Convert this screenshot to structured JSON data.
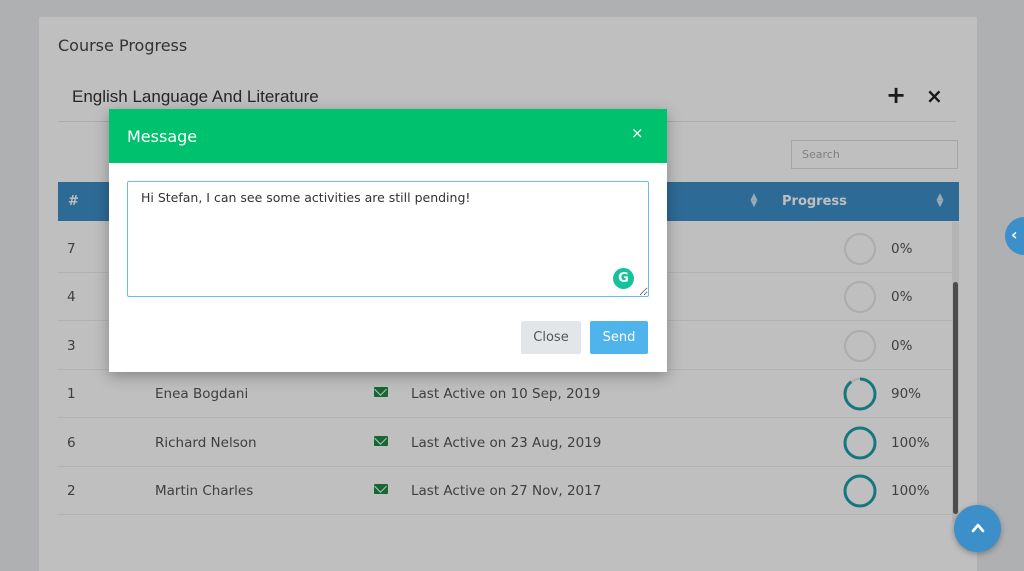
{
  "page": {
    "title": "Course Progress"
  },
  "panel": {
    "title": "English Language And Literature",
    "add_label": "+",
    "close_label": "×"
  },
  "search": {
    "placeholder": "Search"
  },
  "table": {
    "headers": {
      "index": "#",
      "progress": "Progress"
    },
    "rows": [
      {
        "index": "7",
        "name": "",
        "status": "",
        "progress": "0%",
        "progress_value": 0
      },
      {
        "index": "4",
        "name": "",
        "status": "",
        "progress": "0%",
        "progress_value": 0
      },
      {
        "index": "3",
        "name": "",
        "status": "",
        "progress": "0%",
        "progress_value": 0
      },
      {
        "index": "1",
        "name": "Enea Bogdani",
        "status": "Last Active on 10 Sep, 2019",
        "progress": "90%",
        "progress_value": 90
      },
      {
        "index": "6",
        "name": "Richard Nelson",
        "status": "Last Active on 23 Aug, 2019",
        "progress": "100%",
        "progress_value": 100
      },
      {
        "index": "2",
        "name": "Martin Charles",
        "status": "Last Active on 27 Nov, 2017",
        "progress": "100%",
        "progress_value": 100
      }
    ]
  },
  "modal": {
    "title": "Message",
    "close_x": "×",
    "message": "Hi Stefan, I can see some activities are still pending!",
    "close_label": "Close",
    "send_label": "Send"
  },
  "colors": {
    "header_blue": "#3d8fc9",
    "modal_green": "#00c26e",
    "ring_teal": "#1f9faa",
    "send_blue": "#4fb3ec",
    "mail_green": "#1e8a44"
  },
  "icons": {
    "add": "plus-icon",
    "remove": "close-icon",
    "mail": "envelope-icon",
    "sort": "sort-icon",
    "grammarly": "grammarly-icon",
    "scroll_top": "chevron-up-icon",
    "side_toggle": "chevron-left-icon"
  }
}
